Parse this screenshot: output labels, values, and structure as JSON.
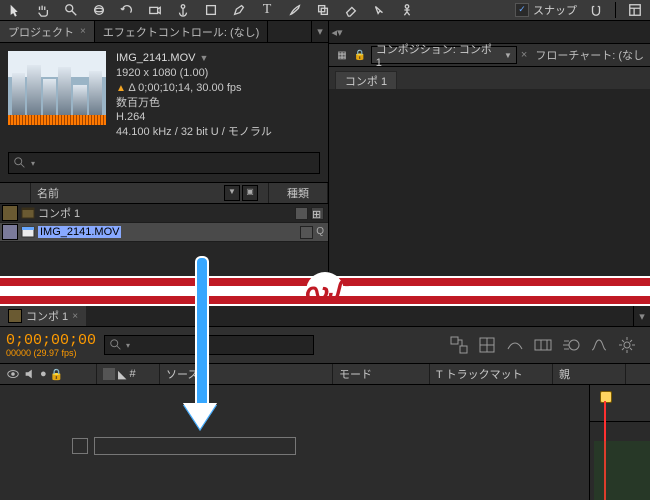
{
  "toolbar": {
    "snap_label": "スナップ",
    "snap_checked": "✓"
  },
  "project": {
    "tab_project": "プロジェクト",
    "tab_effect": "エフェクトコントロール: (なし)",
    "file": {
      "name": "IMG_2141.MOV",
      "resolution": "1920 x 1080 (1.00)",
      "duration": "Δ 0;00;10;14, 30.00 fps",
      "colors": "数百万色",
      "codec": "H.264",
      "audio": "44.100 kHz / 32 bit U / モノラル"
    },
    "columns": {
      "name": "名前",
      "type": "種類"
    },
    "rows": [
      {
        "label": "コンポ 1",
        "type": "comp"
      },
      {
        "label": "IMG_2141.MOV",
        "type": "file",
        "selected": true
      }
    ]
  },
  "comp_panel": {
    "label": "コンポジション: コンポ 1",
    "flow_label": "フローチャート: (なし",
    "chip": "コンポ 1"
  },
  "timeline": {
    "tab": "コンポ 1",
    "timecode": "0;00;00;00",
    "frames": "00000 (29.97 fps)",
    "columns": {
      "num": "#",
      "source": "ソース名",
      "mode": "モード",
      "track": "T トラックマット",
      "parent": "親"
    }
  }
}
